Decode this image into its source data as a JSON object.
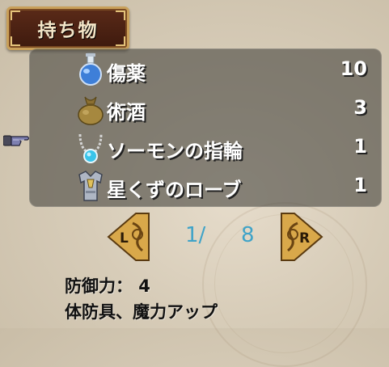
{
  "title": "持ち物",
  "items": [
    {
      "name": "傷薬",
      "qty": "10",
      "icon": "potion-icon"
    },
    {
      "name": "術酒",
      "qty": "3",
      "icon": "sack-icon"
    },
    {
      "name": "ソーモンの指輪",
      "qty": "1",
      "icon": "necklace-icon"
    },
    {
      "name": "星くずのローブ",
      "qty": "1",
      "icon": "armor-icon"
    }
  ],
  "pager": {
    "left_label": "L",
    "right_label": "R",
    "current": "1/",
    "total": "8"
  },
  "description": {
    "stat": "防御力： 4",
    "effect": "体防具、魔力アップ"
  },
  "colors": {
    "title_plate": "#4a2214",
    "panel": "#4b4842",
    "page_text": "#3fa3c8",
    "pager_gold": "#d9a84a"
  }
}
